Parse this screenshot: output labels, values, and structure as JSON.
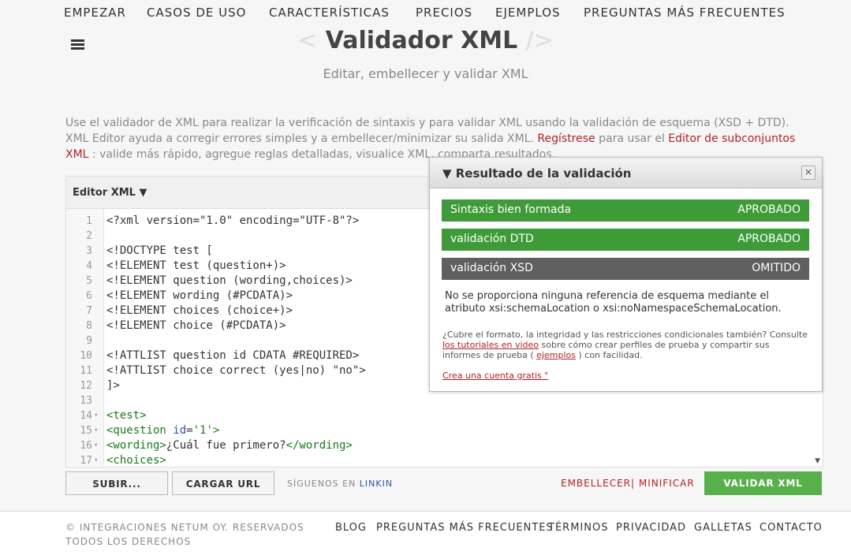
{
  "nav": {
    "items": [
      "EMPEZAR",
      "CASOS DE USO",
      "CARACTERÍSTICAS",
      "PRECIOS",
      "EJEMPLOS",
      "PREGUNTAS MÁS FRECUENTES"
    ]
  },
  "header": {
    "bracket_left": "<",
    "title": "Validador XML",
    "bracket_right": "/>",
    "subtitle": "Editar, embellecer y validar XML"
  },
  "intro": {
    "part1": "Use el validador de XML para realizar la verificación de sintaxis y para validar XML usando la validación de esquema (XSD + DTD). XML Editor ayuda a corregir errores simples y a embellecer/minimizar su salida XML.",
    "link1": "Regístrese",
    "part2": "para usar el",
    "link2": "Editor de subconjuntos XML",
    "part3": ": valide más rápido, agregue reglas detalladas, visualice XML, comparta resultados."
  },
  "editor": {
    "label": "Editor XML ▼",
    "lines": [
      {
        "n": "1",
        "fold": "",
        "text": "<?xml version=\"1.0\" encoding=\"UTF-8\"?>"
      },
      {
        "n": "2",
        "fold": "",
        "text": ""
      },
      {
        "n": "3",
        "fold": "",
        "text": "<!DOCTYPE test ["
      },
      {
        "n": "4",
        "fold": "",
        "text": "<!ELEMENT test (question+)>"
      },
      {
        "n": "5",
        "fold": "",
        "text": "<!ELEMENT question (wording,choices)>"
      },
      {
        "n": "6",
        "fold": "",
        "text": "<!ELEMENT wording (#PCDATA)>"
      },
      {
        "n": "7",
        "fold": "",
        "text": "<!ELEMENT choices (choice+)>"
      },
      {
        "n": "8",
        "fold": "",
        "text": "<!ELEMENT choice (#PCDATA)>"
      },
      {
        "n": "9",
        "fold": "",
        "text": ""
      },
      {
        "n": "10",
        "fold": "",
        "text": "<!ATTLIST question id CDATA #REQUIRED>"
      },
      {
        "n": "11",
        "fold": "",
        "text": "<!ATTLIST choice correct (yes|no) \"no\">"
      },
      {
        "n": "12",
        "fold": "",
        "text": "]>"
      },
      {
        "n": "13",
        "fold": "",
        "text": ""
      },
      {
        "n": "14",
        "fold": "▾",
        "text": "<test>"
      },
      {
        "n": "15",
        "fold": "▾",
        "text": "<question id='1'>"
      },
      {
        "n": "16",
        "fold": "▾",
        "text": "<wording>¿Cuál fue primero?</wording>"
      },
      {
        "n": "17",
        "fold": "▾",
        "text": "<choices>"
      }
    ]
  },
  "toolbar": {
    "upload": "SUBIR...",
    "load_url": "CARGAR URL",
    "follow": "SÍGUENOS EN",
    "follow_link": "LINKIN",
    "beautify": "EMBELLECER",
    "separator": "|",
    "minify": "MINIFICAR",
    "validate": "VALIDAR XML"
  },
  "result": {
    "title": "▼  Resultado de la validación",
    "close": "×",
    "rows": [
      {
        "label": "Sintaxis bien formada",
        "status": "APROBADO",
        "kind": "pass"
      },
      {
        "label": "validación DTD",
        "status": "APROBADO",
        "kind": "pass"
      },
      {
        "label": "validación XSD",
        "status": "OMITIDO",
        "kind": "skip"
      }
    ],
    "note": "No se proporciona ninguna referencia de esquema mediante el atributo xsi:schemaLocation o xsi:noNamespaceSchemaLocation.",
    "small1": "¿Cubre el formato, la integridad y las restricciones condicionales también? Consulte",
    "small_link1": "los tutoriales en video",
    "small2": "sobre cómo crear perfiles de prueba y compartir sus informes de prueba (",
    "small_link2": "ejemplos",
    "small3": ") con facilidad.",
    "signup": "Crea una cuenta gratis \""
  },
  "footer": {
    "copyright": "© INTEGRACIONES NETUM OY. RESERVADOS TODOS LOS DERECHOS",
    "links": [
      "BLOG",
      "PREGUNTAS MÁS FRECUENTES",
      "TÉRMINOS",
      "PRIVACIDAD",
      "GALLETAS",
      "CONTACTO"
    ]
  },
  "colors": {
    "pass": "#3e9b38",
    "skip": "#5f5f5f",
    "accent_link": "#b22222",
    "validate_button": "#58b04a"
  }
}
